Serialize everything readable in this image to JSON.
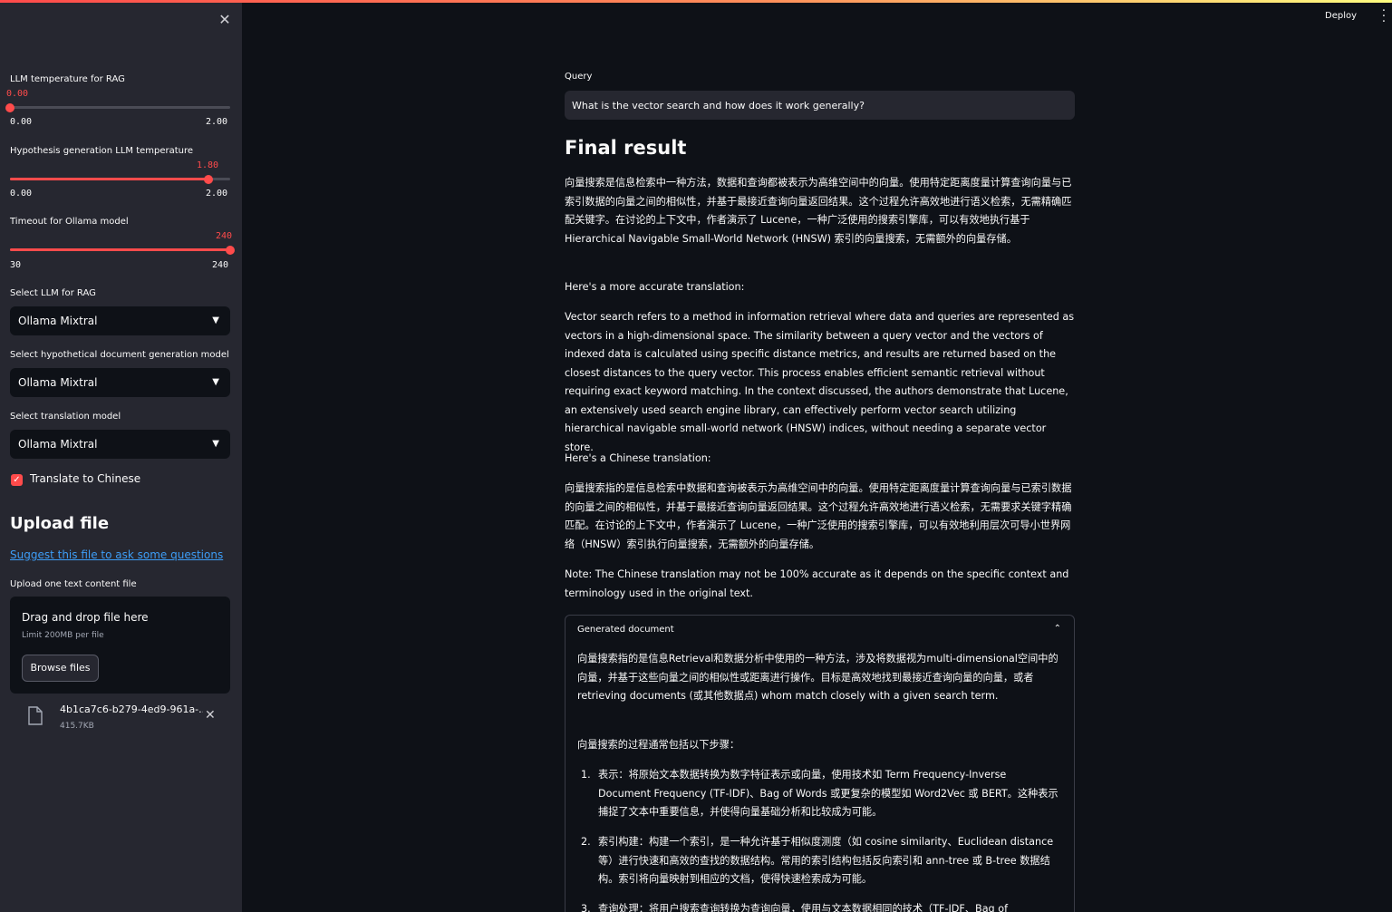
{
  "header": {
    "deploy_label": "Deploy",
    "menu_icon": "kebab-menu-icon"
  },
  "sidebar": {
    "close_icon": "close-icon",
    "slider_rag": {
      "label": "LLM temperature for RAG",
      "value": "0.00",
      "min": "0.00",
      "max": "2.00",
      "fraction": 0.0
    },
    "slider_hyp": {
      "label": "Hypothesis generation LLM temperature",
      "value": "1.80",
      "min": "0.00",
      "max": "2.00",
      "fraction": 0.9
    },
    "slider_timeout": {
      "label": "Timeout for Ollama model",
      "value": "240",
      "min": "30",
      "max": "240",
      "fraction": 1.0
    },
    "select_rag": {
      "label": "Select LLM for RAG",
      "value": "Ollama Mixtral"
    },
    "select_hyp": {
      "label": "Select hypothetical document generation model",
      "value": "Ollama Mixtral"
    },
    "select_trans": {
      "label": "Select translation model",
      "value": "Ollama Mixtral"
    },
    "translate_checkbox": {
      "label": "Translate to Chinese",
      "checked": true
    },
    "upload": {
      "heading": "Upload file",
      "suggest_link": "Suggest this file to ask some questions",
      "label": "Upload one text content file",
      "drop_title": "Drag and drop file here",
      "limit": "Limit 200MB per file",
      "browse_label": "Browse files",
      "file_name": "4b1ca7c6-b279-4ed9-961a-...",
      "file_size": "415.7KB"
    }
  },
  "main": {
    "query_label": "Query",
    "query_value": "What is the vector search and how does it work generally?",
    "final_heading": "Final result",
    "p1": "向量搜索是信息检索中一种方法，数据和查询都被表示为高维空间中的向量。使用特定距离度量计算查询向量与已索引数据的向量之间的相似性，并基于最接近查询向量返回结果。这个过程允许高效地进行语义检索，无需精确匹配关键字。在讨论的上下文中，作者演示了 Lucene，一种广泛使用的搜索引擎库，可以有效地执行基于 Hierarchical Navigable Small-World Network (HNSW) 索引的向量搜索，无需额外的向量存储。",
    "p2": "Here's a more accurate translation:",
    "p3": "Vector search refers to a method in information retrieval where data and queries are represented as vectors in a high-dimensional space. The similarity between a query vector and the vectors of indexed data is calculated using specific distance metrics, and results are returned based on the closest distances to the query vector. This process enables efficient semantic retrieval without requiring exact keyword matching. In the context discussed, the authors demonstrate that Lucene, an extensively used search engine library, can effectively perform vector search utilizing hierarchical navigable small-world network (HNSW) indices, without needing a separate vector store.",
    "p4": "Here's a Chinese translation:",
    "p5": "向量搜索指的是信息检索中数据和查询被表示为高维空间中的向量。使用特定距离度量计算查询向量与已索引数据的向量之间的相似性，并基于最接近查询向量返回结果。这个过程允许高效地进行语义检索，无需要求关键字精确匹配。在讨论的上下文中，作者演示了 Lucene，一种广泛使用的搜索引擎库，可以有效地利用层次可导小世界网络（HNSW）索引执行向量搜索，无需额外的向量存储。",
    "p6": "Note: The Chinese translation may not be 100% accurate as it depends on the specific context and terminology used in the original text.",
    "expander": {
      "title": "Generated document",
      "intro": "向量搜索指的是信息Retrieval和数据分析中使用的一种方法，涉及将数据视为multi-dimensional空间中的向量，并基于这些向量之间的相似性或距离进行操作。目标是高效地找到最接近查询向量的向量，或者 retrieving documents (或其他数据点) whom match closely with a given search term.",
      "steps_intro": "向量搜索的过程通常包括以下步骤：",
      "items": [
        {
          "num": "1.",
          "text": "表示：将原始文本数据转换为数字特征表示或向量，使用技术如 Term Frequency-Inverse Document Frequency (TF-IDF)、Bag of Words 或更复杂的模型如 Word2Vec 或 BERT。这种表示捕捉了文本中重要信息，并使得向量基础分析和比较成为可能。"
        },
        {
          "num": "2.",
          "text": "索引构建：构建一个索引，是一种允许基于相似度测度（如 cosine similarity、Euclidean distance 等）进行快速和高效的查找的数据结构。常用的索引结构包括反向索引和 ann-tree 或 B-tree 数据结构。索引将向量映射到相应的文档，使得快速检索成为可能。"
        },
        {
          "num": "3.",
          "text": "查询处理：将用户搜索查询转换为查询向量，使用与文本数据相同的技术（TF-IDF、Bag of"
        }
      ]
    }
  },
  "colors": {
    "accent": "#ff4b4b",
    "background": "#0e1117",
    "sidebar": "#262730",
    "link": "#3d9df6"
  }
}
